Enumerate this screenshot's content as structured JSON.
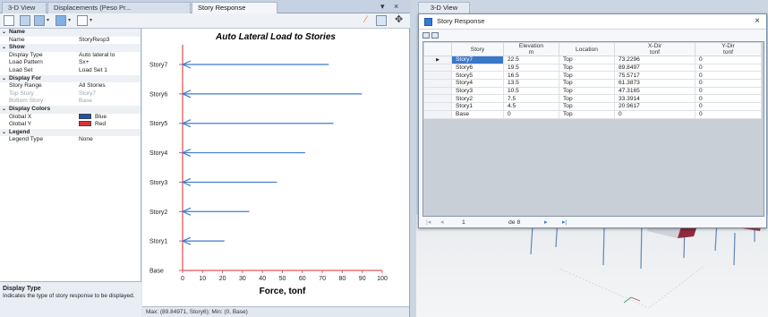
{
  "left_tabs": [
    "3-D View",
    "Displacements (Peso Pr...",
    "Story Response"
  ],
  "left_tab_controls": [
    "▾",
    "×"
  ],
  "properties": [
    {
      "kind": "cat",
      "key": "Name"
    },
    {
      "kind": "row",
      "key": "Name",
      "value": "StoryResp3"
    },
    {
      "kind": "cat",
      "key": "Show"
    },
    {
      "kind": "row",
      "key": "Display Type",
      "value": "Auto lateral lo"
    },
    {
      "kind": "row",
      "key": "Load Pattern",
      "value": "Sx+"
    },
    {
      "kind": "row",
      "key": "Load Set",
      "value": "Load Set 1"
    },
    {
      "kind": "cat",
      "key": "Display For"
    },
    {
      "kind": "row",
      "key": "Story Range",
      "value": "All Stories"
    },
    {
      "kind": "dim",
      "key": "Top Story",
      "value": "Story7"
    },
    {
      "kind": "dim",
      "key": "Bottom Story",
      "value": "Base"
    },
    {
      "kind": "cat",
      "key": "Display Colors"
    },
    {
      "kind": "color",
      "key": "Global X",
      "value": "Blue",
      "color": "#1f4fb8"
    },
    {
      "kind": "color",
      "key": "Global Y",
      "value": "Red",
      "color": "#d6323e"
    },
    {
      "kind": "cat",
      "key": "Legend"
    },
    {
      "kind": "row",
      "key": "Legend Type",
      "value": "None"
    }
  ],
  "description": {
    "title": "Display Type",
    "text": "Indicates the type of story response to be displayed."
  },
  "chart_data": {
    "type": "bar",
    "title": "Auto Lateral Load to Stories",
    "xlabel": "Force, tonf",
    "ylabel": "",
    "categories": [
      "Story7",
      "Story6",
      "Story5",
      "Story4",
      "Story3",
      "Story2",
      "Story1",
      "Base"
    ],
    "values": [
      73.2296,
      89.8497,
      75.5717,
      61.3873,
      47.3165,
      33.3914,
      20.9617,
      0
    ],
    "xlim": [
      0,
      100
    ],
    "xticks": [
      0,
      10,
      20,
      30,
      40,
      50,
      60,
      70,
      80,
      90,
      100
    ],
    "series_color": "#3d7bd0",
    "axis_color": "#e0585c"
  },
  "status_text": "Max: (89.84971, Story6);  Min: (0, Base)",
  "right_tab": "3-D View",
  "window": {
    "title": "Story Response",
    "close": "×",
    "columns": [
      {
        "label": "Story",
        "unit": ""
      },
      {
        "label": "Elevation",
        "unit": "m"
      },
      {
        "label": "Location",
        "unit": ""
      },
      {
        "label": "X-Dir",
        "unit": "tonf"
      },
      {
        "label": "Y-Dir",
        "unit": "tonf"
      }
    ],
    "rows": [
      [
        "Story7",
        "22.5",
        "Top",
        "73.2296",
        "0"
      ],
      [
        "Story6",
        "19.5",
        "Top",
        "89.8497",
        "0"
      ],
      [
        "Story5",
        "16.5",
        "Top",
        "75.5717",
        "0"
      ],
      [
        "Story4",
        "13.5",
        "Top",
        "61.3873",
        "0"
      ],
      [
        "Story3",
        "10.5",
        "Top",
        "47.3165",
        "0"
      ],
      [
        "Story2",
        "7.5",
        "Top",
        "33.3914",
        "0"
      ],
      [
        "Story1",
        "4.5",
        "Top",
        "20.9617",
        "0"
      ],
      [
        "Base",
        "0",
        "Top",
        "0",
        "0"
      ]
    ],
    "active_row": 0,
    "nav": {
      "first": "|◂",
      "prev": "◂",
      "page": "1",
      "of": "de 8",
      "next": "▸",
      "last": "▸|"
    }
  }
}
